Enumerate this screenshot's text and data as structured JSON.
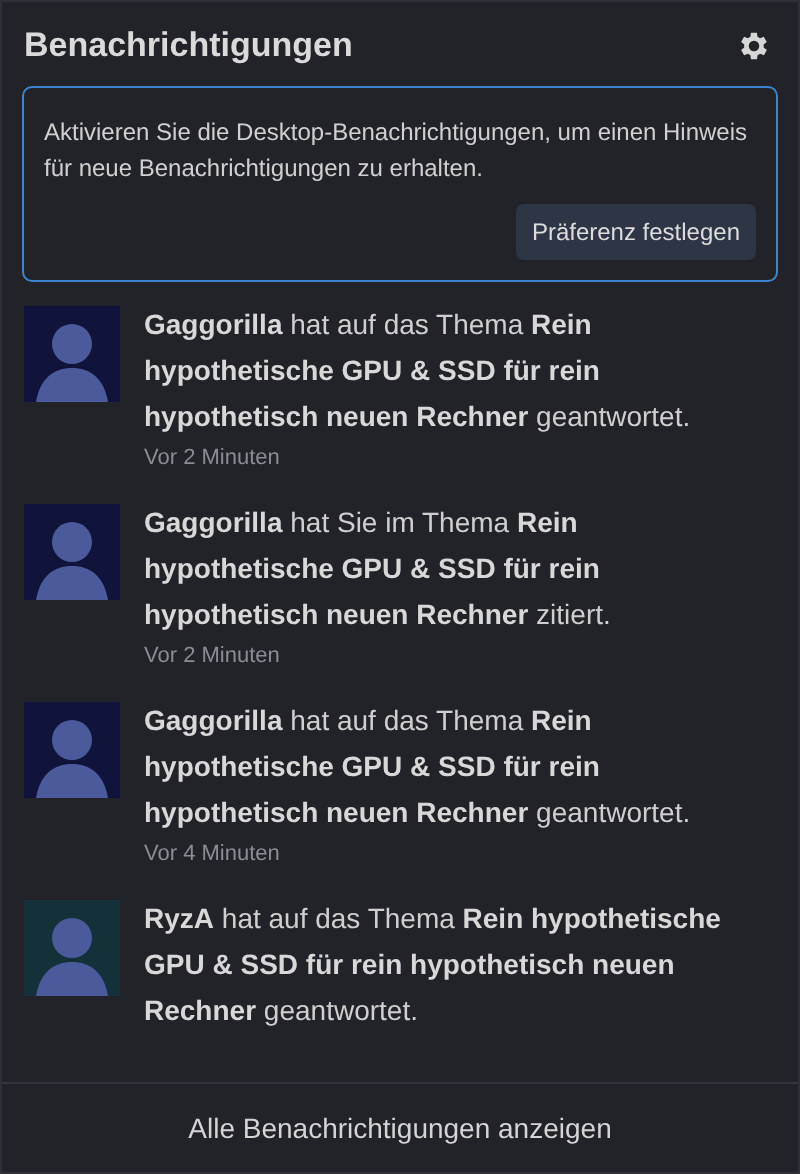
{
  "header": {
    "title": "Benachrichtigungen"
  },
  "alert": {
    "message": "Aktivieren Sie die Desktop-Benachrichtigungen, um einen Hinweis für neue Benachrichtigungen zu erhalten.",
    "button": "Präferenz festlegen"
  },
  "notifications": [
    {
      "text": "**Gaggorilla** hat auf das Thema **Rein hypothetische GPU & SSD für rein hypothetisch neuen Rechner** geantwortet.",
      "time": "Vor 2 Minuten",
      "color": "#10143a"
    },
    {
      "text": "**Gaggorilla** hat Sie im Thema **Rein hypothetische GPU & SSD für rein hypothetisch neuen Rechner** zitiert.",
      "time": "Vor 2 Minuten",
      "color": "#10143a"
    },
    {
      "text": "**Gaggorilla** hat auf das Thema **Rein hypothetische GPU & SSD für rein hypothetisch neuen Rechner** geantwortet.",
      "time": "Vor 4 Minuten",
      "color": "#10143a"
    },
    {
      "text": "**RyzA** hat auf das Thema **Rein hypothetische GPU & SSD für rein hypothetisch neuen Rechner** geantwortet.",
      "color": "#143038"
    }
  ],
  "footer": {
    "link": "Alle Benachrichtigungen anzeigen"
  }
}
